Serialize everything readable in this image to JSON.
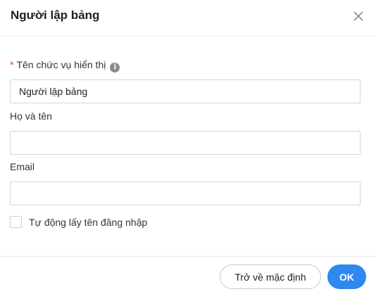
{
  "dialog": {
    "title": "Người lập bảng"
  },
  "form": {
    "position_label": "Tên chức vụ hiển thị",
    "required_mark": "*",
    "info_glyph": "i",
    "position_value": "Người lập bảng",
    "fullname_label": "Họ và tên",
    "fullname_value": "",
    "email_label": "Email",
    "email_value": "",
    "auto_label": "Tự động lấy tên đăng nhập",
    "auto_checked": false
  },
  "footer": {
    "reset_label": "Trở về mặc định",
    "ok_label": "OK"
  },
  "colors": {
    "primary": "#2f88f0",
    "required": "#e8413c",
    "border": "#d6d6d6"
  },
  "icons": {
    "close": "close-icon",
    "info": "info-icon"
  }
}
